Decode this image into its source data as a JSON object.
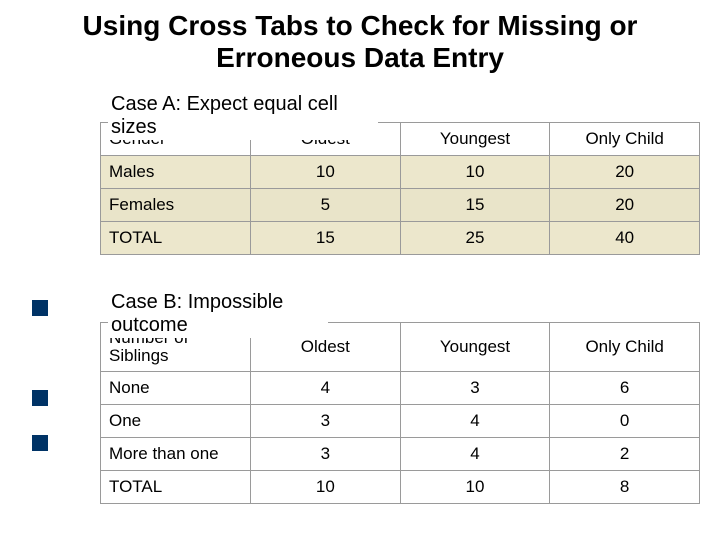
{
  "title": "Using Cross Tabs to Check for Missing or Erroneous Data Entry",
  "caseA": {
    "label_line1": "Case A:  Expect equal cell",
    "label_line2": "sizes",
    "header_row_label": "Gender",
    "cols": [
      "Oldest",
      "Youngest",
      "Only Child"
    ],
    "rows": [
      {
        "label": "Males",
        "v": [
          "10",
          "10",
          "20"
        ]
      },
      {
        "label": "Females",
        "v": [
          "5",
          "15",
          "20"
        ]
      },
      {
        "label": "TOTAL",
        "v": [
          "15",
          "25",
          "40"
        ]
      }
    ]
  },
  "caseB": {
    "label_line1": "Case B:  Impossible",
    "label_line2": "outcome",
    "header_row_label_l1": "Number of",
    "header_row_label_l2": "Siblings",
    "cols": [
      "Oldest",
      "Youngest",
      "Only Child"
    ],
    "rows": [
      {
        "label": "None",
        "v": [
          "4",
          "3",
          "6"
        ]
      },
      {
        "label": "One",
        "v": [
          "3",
          "4",
          "0"
        ]
      },
      {
        "label": "More than one",
        "v": [
          "3",
          "4",
          "2"
        ]
      },
      {
        "label": "TOTAL",
        "v": [
          "10",
          "10",
          "8"
        ]
      }
    ]
  },
  "chart_data": [
    {
      "type": "table",
      "title": "Case A: Expect equal cell sizes",
      "row_field": "Gender",
      "columns": [
        "Oldest",
        "Youngest",
        "Only Child"
      ],
      "rows": [
        {
          "Gender": "Males",
          "Oldest": 10,
          "Youngest": 10,
          "Only Child": 20
        },
        {
          "Gender": "Females",
          "Oldest": 5,
          "Youngest": 15,
          "Only Child": 20
        },
        {
          "Gender": "TOTAL",
          "Oldest": 15,
          "Youngest": 25,
          "Only Child": 40
        }
      ]
    },
    {
      "type": "table",
      "title": "Case B: Impossible outcome",
      "row_field": "Number of Siblings",
      "columns": [
        "Oldest",
        "Youngest",
        "Only Child"
      ],
      "rows": [
        {
          "Number of Siblings": "None",
          "Oldest": 4,
          "Youngest": 3,
          "Only Child": 6
        },
        {
          "Number of Siblings": "One",
          "Oldest": 3,
          "Youngest": 4,
          "Only Child": 0
        },
        {
          "Number of Siblings": "More than one",
          "Oldest": 3,
          "Youngest": 4,
          "Only Child": 2
        },
        {
          "Number of Siblings": "TOTAL",
          "Oldest": 10,
          "Youngest": 10,
          "Only Child": 8
        }
      ]
    }
  ]
}
